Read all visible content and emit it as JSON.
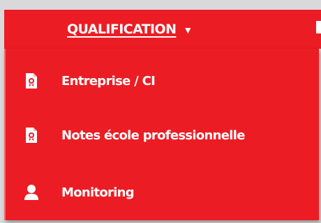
{
  "nav": {
    "qualification_label": "QUALIFICATION",
    "caret_icon": "caret-down-icon"
  },
  "menu": {
    "items": [
      {
        "label": "Entreprise / CI",
        "icon": "certificate-document-icon"
      },
      {
        "label": "Notes école professionnelle",
        "icon": "certificate-document-icon"
      },
      {
        "label": "Monitoring",
        "icon": "user-icon"
      }
    ]
  },
  "colors": {
    "brand_red": "#ec1c24",
    "text": "#ffffff",
    "background": "#d9d9db"
  }
}
